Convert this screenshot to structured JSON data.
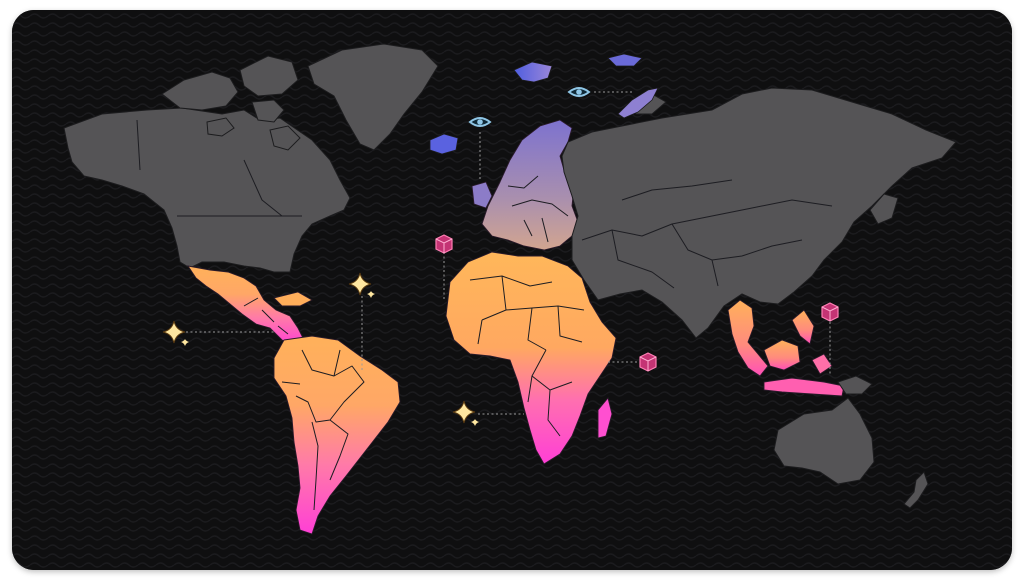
{
  "colors": {
    "background": "#0f0f10",
    "land": "#555456",
    "highlight_orange": "#ffb15a",
    "highlight_pink": "#ff3fd6",
    "highlight_purple": "#8c7cc8",
    "arctic_blue": "#5a62e0",
    "marker_box": "#e8478e",
    "marker_eye": "#8fc6e6",
    "marker_sparkle": "#ffe7a0"
  },
  "markers": [
    {
      "region": "svalbard",
      "icon": "eye-icon"
    },
    {
      "region": "scandinavia",
      "icon": "eye-icon"
    },
    {
      "region": "west-africa",
      "icon": "box-icon"
    },
    {
      "region": "east-africa",
      "icon": "box-icon"
    },
    {
      "region": "southeast-asia",
      "icon": "box-icon"
    },
    {
      "region": "central-america",
      "icon": "sparkle-icon"
    },
    {
      "region": "amazon",
      "icon": "sparkle-icon"
    },
    {
      "region": "southern-africa",
      "icon": "sparkle-icon"
    }
  ]
}
